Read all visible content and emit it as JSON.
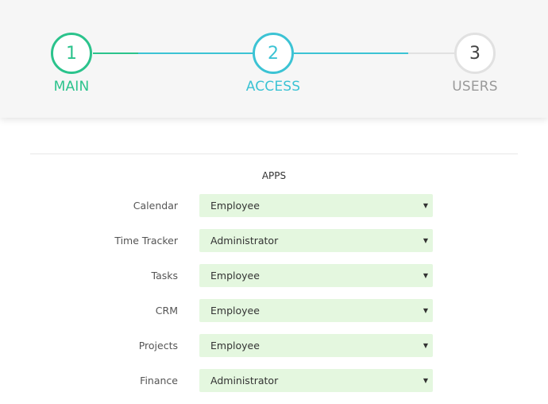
{
  "stepper": {
    "steps": [
      {
        "number": "1",
        "label": "MAIN",
        "state": "completed"
      },
      {
        "number": "2",
        "label": "ACCESS",
        "state": "active"
      },
      {
        "number": "3",
        "label": "USERS",
        "state": "pending"
      }
    ],
    "colors": {
      "completed": "#2bc38c",
      "active": "#3cc3d4",
      "pending": "#e1e1e1",
      "pending_label": "#9a9a9a"
    }
  },
  "apps": {
    "title": "APPS",
    "rows": [
      {
        "label": "Calendar",
        "value": "Employee"
      },
      {
        "label": "Time Tracker",
        "value": "Administrator"
      },
      {
        "label": "Tasks",
        "value": "Employee"
      },
      {
        "label": "CRM",
        "value": "Employee"
      },
      {
        "label": "Projects",
        "value": "Employee"
      },
      {
        "label": "Finance",
        "value": "Administrator"
      }
    ],
    "select_bg_color": "#e4f7df"
  },
  "icons": {
    "dropdown": "caret-down-icon"
  }
}
